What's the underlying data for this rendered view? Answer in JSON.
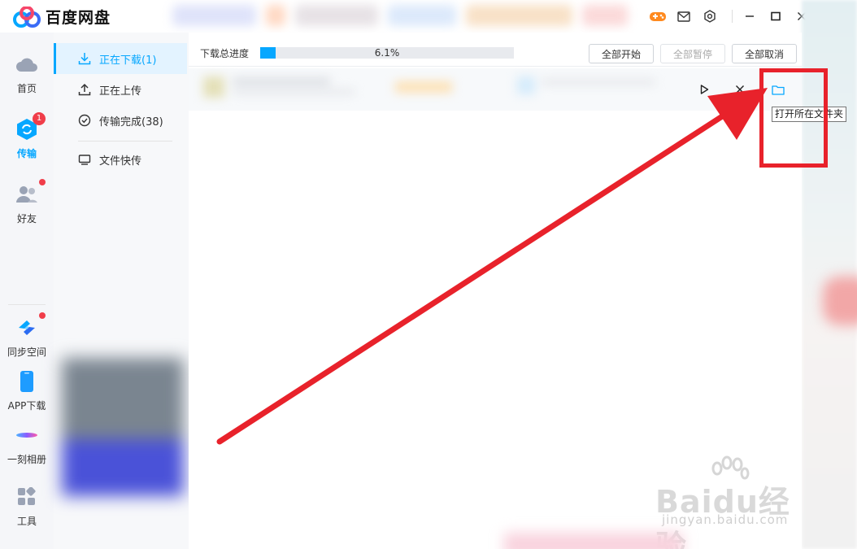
{
  "app": {
    "title": "百度网盘"
  },
  "titlebar": {
    "icons": [
      "game-controller-icon",
      "mail-icon",
      "settings-icon",
      "minimize-icon",
      "maximize-icon",
      "close-icon"
    ]
  },
  "leftnav": {
    "items": [
      {
        "label": "首页",
        "icon": "cloud-icon"
      },
      {
        "label": "传输",
        "icon": "transfer-icon",
        "badge": "1",
        "active": true
      },
      {
        "label": "好友",
        "icon": "friends-icon",
        "dot": true
      },
      {
        "label": "同步空间",
        "icon": "sync-space-icon",
        "dot": true
      },
      {
        "label": "APP下载",
        "icon": "phone-icon"
      },
      {
        "label": "一刻相册",
        "icon": "album-icon"
      },
      {
        "label": "工具",
        "icon": "tools-icon"
      }
    ]
  },
  "subnav": {
    "items": [
      {
        "label": "正在下载(1)",
        "icon": "download-icon",
        "active": true
      },
      {
        "label": "正在上传",
        "icon": "upload-icon"
      },
      {
        "label": "传输完成(38)",
        "icon": "check-circle-icon"
      },
      {
        "label": "文件快传",
        "icon": "monitor-icon"
      }
    ]
  },
  "main": {
    "progress_label": "下载总进度",
    "progress_text": "6.1%",
    "progress_fraction": 0.061,
    "buttons": {
      "start_all": "全部开始",
      "pause_all": "全部暂停",
      "cancel_all": "全部取消"
    },
    "row_controls": [
      "play-icon",
      "close-icon",
      "folder-icon"
    ],
    "tooltip": "打开所在文件夹"
  },
  "watermark": {
    "main": "Baidu经验",
    "url": "jingyan.baidu.com"
  },
  "colors": {
    "accent": "#06a7ff",
    "badge": "#f03d4a",
    "annotation": "#e8222b"
  }
}
